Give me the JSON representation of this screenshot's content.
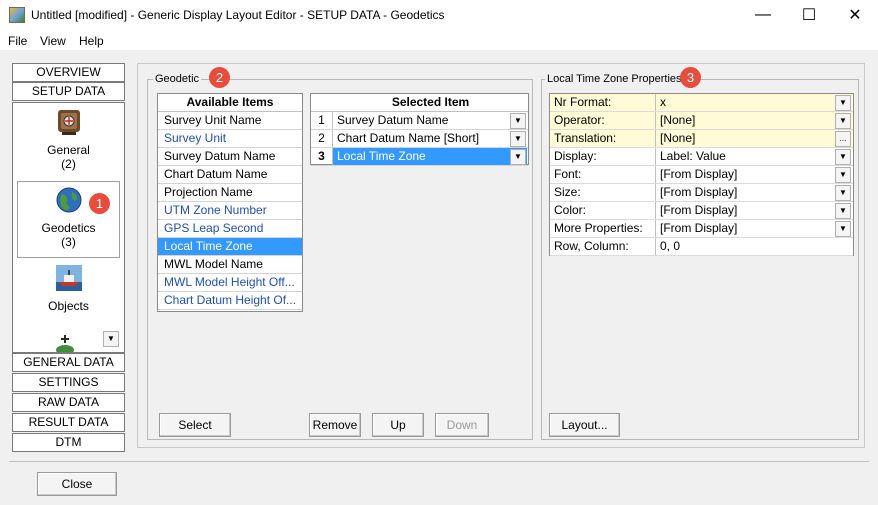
{
  "window": {
    "title": "Untitled [modified] - Generic Display Layout Editor -  SETUP DATA -  Geodetics",
    "minimize": "—",
    "maximize": "☐",
    "close": "✕"
  },
  "menu": [
    "File",
    "View",
    "Help"
  ],
  "nav": {
    "top_tabs": [
      "OVERVIEW",
      "SETUP DATA"
    ],
    "items": [
      {
        "label": "General",
        "count": "(2)",
        "icon": "general-setup-icon"
      },
      {
        "label": "Geodetics",
        "count": "(3)",
        "icon": "globe-icon"
      },
      {
        "label": "Objects",
        "count": "",
        "icon": "ship-icon"
      }
    ],
    "scroll_arrow": "▼",
    "bottom_tabs": [
      "GENERAL DATA",
      "SETTINGS",
      "RAW DATA",
      "RESULT DATA",
      "DTM"
    ],
    "badge": "1"
  },
  "geodetic": {
    "group_title": "Geodetic",
    "badge": "2",
    "available_header": "Available Items",
    "available_items": [
      {
        "label": "Survey Unit Name",
        "style": "black"
      },
      {
        "label": "Survey Unit",
        "style": "blue"
      },
      {
        "label": "Survey Datum Name",
        "style": "black"
      },
      {
        "label": "Chart Datum Name",
        "style": "black"
      },
      {
        "label": "Projection Name",
        "style": "black"
      },
      {
        "label": "UTM Zone Number",
        "style": "blue"
      },
      {
        "label": "GPS Leap Second",
        "style": "blue"
      },
      {
        "label": "Local Time Zone",
        "style": "selected"
      },
      {
        "label": "MWL Model Name",
        "style": "black"
      },
      {
        "label": "MWL Model Height Off...",
        "style": "blue"
      },
      {
        "label": "Chart Datum Height Of...",
        "style": "blue"
      }
    ],
    "selected_header": "Selected Item",
    "selected_items": [
      {
        "num": "1",
        "label": "Survey Datum Name"
      },
      {
        "num": "2",
        "label": "Chart Datum Name [Short]"
      },
      {
        "num": "3",
        "label": "Local Time Zone"
      }
    ],
    "buttons": {
      "select": "Select",
      "remove": "Remove",
      "up": "Up",
      "down": "Down"
    }
  },
  "properties": {
    "group_title": "Local Time Zone Properties",
    "badge": "3",
    "rows": [
      {
        "name": "Nr Format:",
        "value": "x",
        "control": "dropdown",
        "hl": true
      },
      {
        "name": "Operator:",
        "value": "[None]",
        "control": "dropdown",
        "hl": true
      },
      {
        "name": "Translation:",
        "value": "[None]",
        "control": "ellipsis",
        "hl": true
      },
      {
        "name": "Display:",
        "value": "Label: Value",
        "control": "dropdown",
        "hl": false
      },
      {
        "name": "Font:",
        "value": "[From Display]",
        "control": "dropdown",
        "hl": false
      },
      {
        "name": "Size:",
        "value": "[From Display]",
        "control": "dropdown",
        "hl": false
      },
      {
        "name": "Color:",
        "value": " [From Display]",
        "control": "dropdown",
        "hl": false
      },
      {
        "name": "More Properties:",
        "value": "[From Display]",
        "control": "dropdown",
        "hl": false
      },
      {
        "name": "Row, Column:",
        "value": "0, 0",
        "control": "none",
        "hl": false
      }
    ],
    "layout_button": "Layout..."
  },
  "footer": {
    "close": "Close"
  },
  "colors": {
    "selection": "#3399ff",
    "badge": "#e84c3d",
    "link_blue": "#1f4fb4",
    "highlight": "#fffbd6"
  }
}
